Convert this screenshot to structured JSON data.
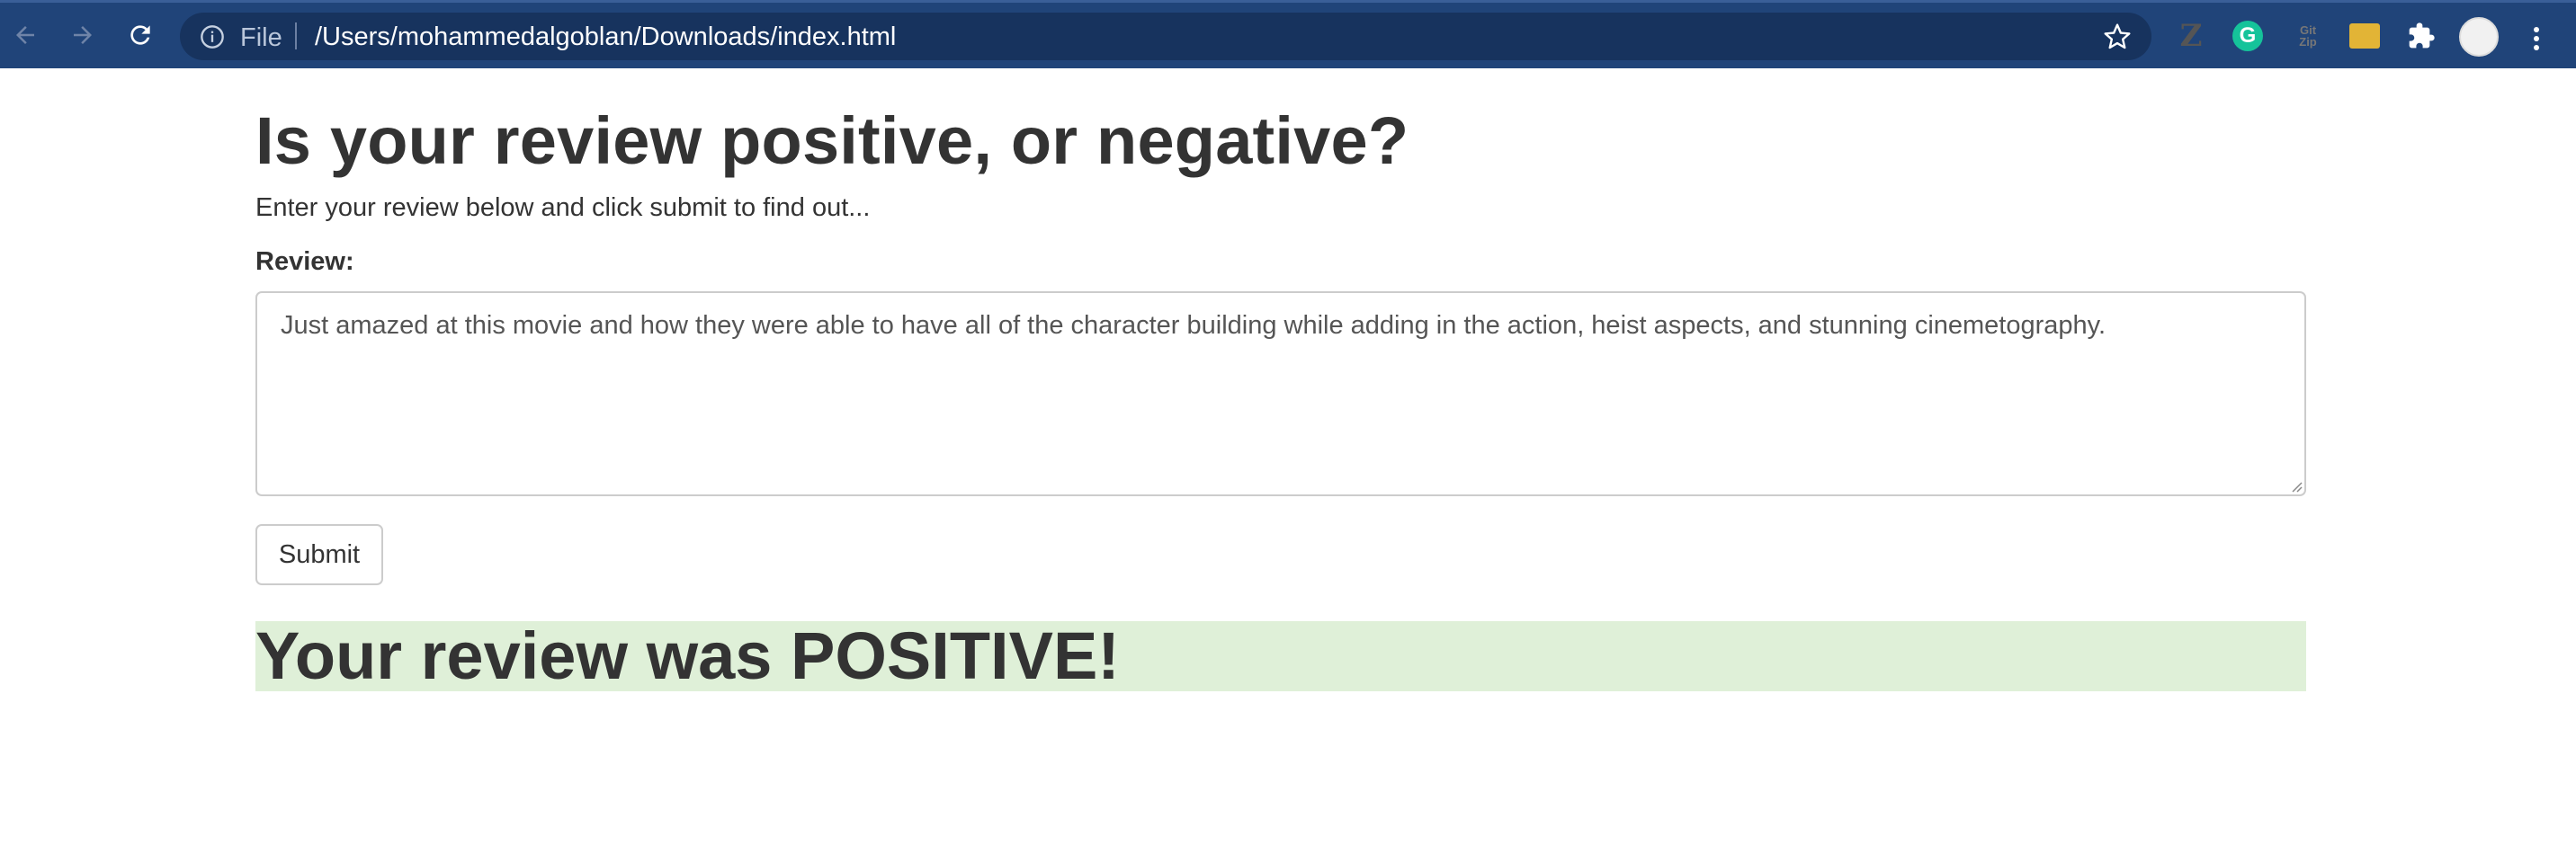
{
  "browser": {
    "scheme_label": "File",
    "url": "/Users/mohammedalgoblan/Downloads/index.html",
    "icons": [
      "back-arrow-icon",
      "forward-arrow-icon",
      "reload-icon",
      "info-icon",
      "star-icon",
      "puzzle-icon",
      "menu-dots-icon"
    ],
    "extensions": {
      "z_label": "Z",
      "grammarly_label": "G",
      "zip_label_1": "Git",
      "zip_label_2": "Zip"
    },
    "colors": {
      "toolbar": "#204479",
      "omnibox": "#17335e"
    }
  },
  "page": {
    "title": "Is your review positive, or negative?",
    "subtitle": "Enter your review below and click submit to find out...",
    "review_label": "Review:",
    "review_text": "Just amazed at this movie and how they were able to have all of the character building while adding in the action, heist aspects, and stunning cinemetography.",
    "submit_label": "Submit",
    "result_text": "Your review was POSITIVE!",
    "colors": {
      "result_bg": "#dff0d8",
      "text": "#333333"
    }
  }
}
